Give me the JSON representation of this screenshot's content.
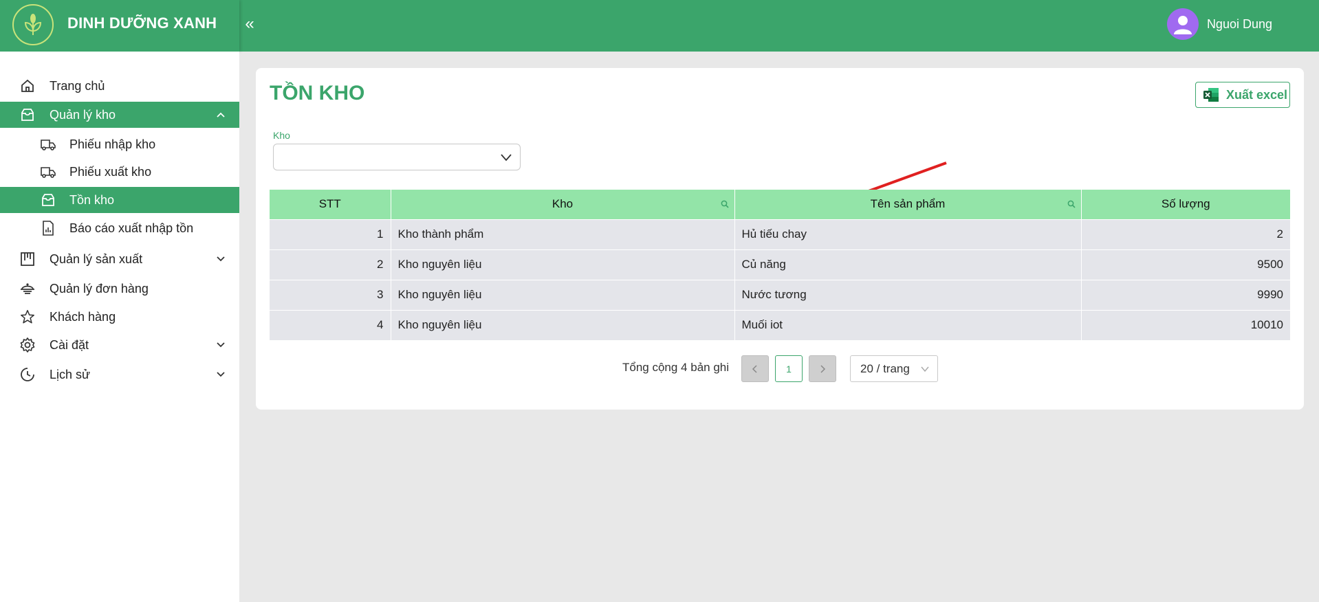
{
  "header": {
    "brand": "DINH DƯỠNG XANH",
    "collapse_icon": "«",
    "user_name": "Nguoi Dung"
  },
  "sidebar": {
    "items": [
      {
        "label": "Trang chủ",
        "icon": "home-icon"
      },
      {
        "label": "Quản lý kho",
        "icon": "inbox-icon",
        "expanded": true
      },
      {
        "label": "Phiếu nhập kho",
        "icon": "truck-in-icon"
      },
      {
        "label": "Phiếu xuất kho",
        "icon": "truck-icon"
      },
      {
        "label": "Tồn kho",
        "icon": "inbox-icon",
        "active": true
      },
      {
        "label": "Báo cáo xuất nhập tồn",
        "icon": "report-icon"
      },
      {
        "label": "Quản lý sản xuất",
        "icon": "factory-icon"
      },
      {
        "label": "Quản lý đơn hàng",
        "icon": "orders-icon"
      },
      {
        "label": "Khách hàng",
        "icon": "star-icon"
      },
      {
        "label": "Cài đặt",
        "icon": "gear-icon"
      },
      {
        "label": "Lịch sử",
        "icon": "history-icon"
      }
    ]
  },
  "main": {
    "title": "TỒN KHO",
    "export_label": "Xuất excel",
    "filter": {
      "label": "Kho",
      "value": ""
    },
    "table": {
      "columns": [
        "STT",
        "Kho",
        "Tên sản phẩm",
        "Số lượng"
      ],
      "rows": [
        [
          "1",
          "Kho thành phẩm",
          "Hủ tiếu chay",
          "2"
        ],
        [
          "2",
          "Kho nguyên liệu",
          "Củ năng",
          "9500"
        ],
        [
          "3",
          "Kho nguyên liệu",
          "Nước tương",
          "9990"
        ],
        [
          "4",
          "Kho nguyên liệu",
          "Muối iot",
          "10010"
        ]
      ]
    },
    "pagination": {
      "total": "Tổng cộng 4 bản ghi",
      "current_page": "1",
      "page_size": "20 / trang"
    }
  },
  "colors": {
    "primary": "#3ba56b",
    "header_row": "#93e4a8",
    "row_bg": "#e4e5ea",
    "arrow": "#e02020",
    "avatar": "#a06af0"
  }
}
